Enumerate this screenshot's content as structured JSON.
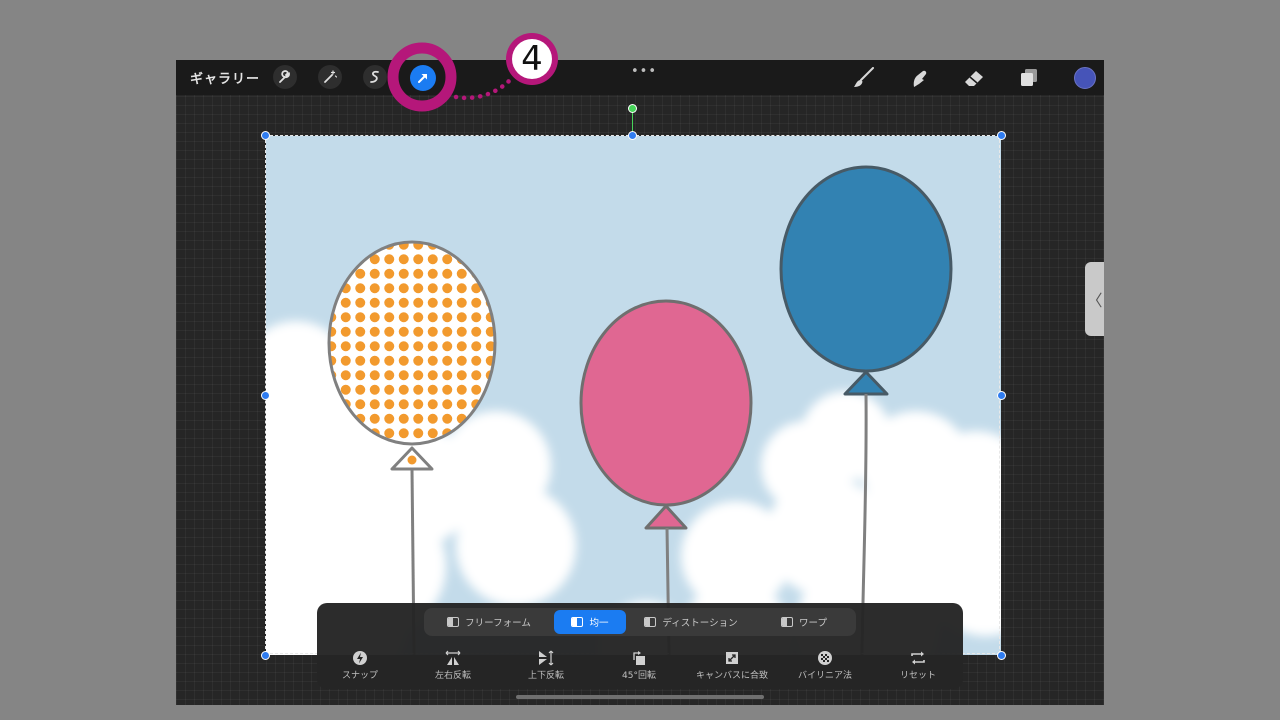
{
  "topbar": {
    "gallery_label": "ギャラリー",
    "more_label": "•••",
    "left_icons": [
      "wrench-icon",
      "magic-wand-icon",
      "selection-s-icon",
      "transform-arrow-icon"
    ],
    "right_icons": [
      "brush-icon",
      "smudge-icon",
      "eraser-icon",
      "layers-icon"
    ],
    "color_swatch": "#4654b8",
    "active_tool_color": "#1b7cf2"
  },
  "annotation": {
    "step_label": "4",
    "color": "#b5177a"
  },
  "side_handle": {
    "label": "〈"
  },
  "transform_panel": {
    "modes": [
      {
        "label": "フリーフォーム",
        "active": false
      },
      {
        "label": "均一",
        "active": true
      },
      {
        "label": "ディストーション",
        "active": false
      },
      {
        "label": "ワープ",
        "active": false
      }
    ],
    "tools": [
      {
        "label": "スナップ",
        "icon": "snap-icon"
      },
      {
        "label": "左右反転",
        "icon": "flip-horizontal-icon"
      },
      {
        "label": "上下反転",
        "icon": "flip-vertical-icon"
      },
      {
        "label": "45°回転",
        "icon": "rotate-45-icon"
      },
      {
        "label": "キャンバスに合致",
        "icon": "fit-to-canvas-icon"
      },
      {
        "label": "バイリニア法",
        "icon": "bilinear-icon"
      },
      {
        "label": "リセット",
        "icon": "reset-icon"
      }
    ]
  },
  "artwork": {
    "sky_color": "#c3dbea",
    "balloons": [
      {
        "name": "polka-dot",
        "color": "#f29a2e"
      },
      {
        "name": "pink",
        "color": "#e06792"
      },
      {
        "name": "blue",
        "color": "#3282b2"
      }
    ]
  }
}
